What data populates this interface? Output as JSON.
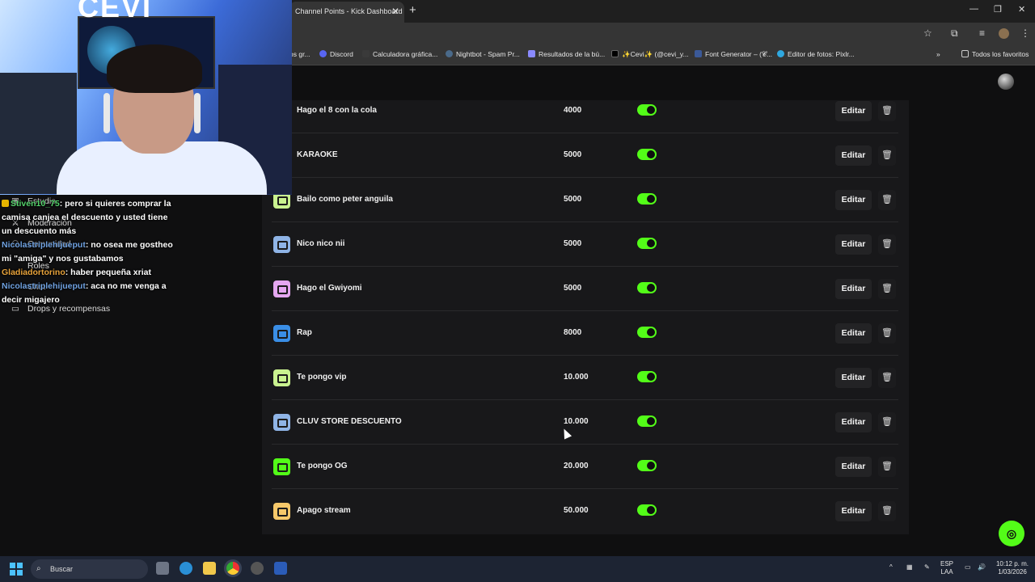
{
  "browser": {
    "tab_title": "Channel Points - Kick Dashboard",
    "tab_close": "✕",
    "new_tab": "+",
    "window_controls": [
      "—",
      "❐",
      "✕"
    ],
    "bookmarks": [
      {
        "label": "os gr...",
        "color": "#5b5b5b"
      },
      {
        "label": "Discord",
        "color": "#5865f2"
      },
      {
        "label": "Calculadora gráfica...",
        "color": "#3a3a3a"
      },
      {
        "label": "Nightbot - Spam Pr...",
        "color": "#4a6a8a"
      },
      {
        "label": "Resultados de la bú...",
        "color": "#8a8aff"
      },
      {
        "label": "✨Cevi✨ (@cevi_y...",
        "color": "#000000"
      },
      {
        "label": "Font Generator – (𝓒...",
        "color": "#3b5998"
      },
      {
        "label": "Editor de fotos: Pixlr...",
        "color": "#2fa8e0"
      }
    ],
    "all_favorites": "Todos los favoritos"
  },
  "rewards": [
    {
      "title": "Hago el 8 con la cola",
      "cost": "4000",
      "icon_color": "#a6f28f"
    },
    {
      "title": "KARAOKE",
      "cost": "5000",
      "icon_color": "#f6c86a"
    },
    {
      "title": "Bailo como peter anguila",
      "cost": "5000",
      "icon_color": "#c9f28f"
    },
    {
      "title": "Nico nico nii",
      "cost": "5000",
      "icon_color": "#8fb4e6"
    },
    {
      "title": "Hago el Gwiyomi",
      "cost": "5000",
      "icon_color": "#e4a6f0"
    },
    {
      "title": "Rap",
      "cost": "8000",
      "icon_color": "#3a8ee6"
    },
    {
      "title": "Te pongo vip",
      "cost": "10.000",
      "icon_color": "#c9f28f"
    },
    {
      "title": "CLUV STORE DESCUENTO",
      "cost": "10.000",
      "icon_color": "#8fb4e6"
    },
    {
      "title": "Te pongo OG",
      "cost": "20.000",
      "icon_color": "#53fc18"
    },
    {
      "title": "Apago stream",
      "cost": "50.000",
      "icon_color": "#f6c86a"
    }
  ],
  "row_actions": {
    "edit": "Editar",
    "delete": "🗑"
  },
  "sidebar": {
    "items": [
      {
        "icon": "▣",
        "label": "Estudio"
      },
      {
        "icon": "",
        "label": "Moderación"
      },
      {
        "icon": "⚇",
        "label": "Comunidad"
      },
      {
        "icon": "",
        "label": "Roles"
      },
      {
        "icon": "",
        "label": "Chat"
      },
      {
        "icon": "▭",
        "label": "Drops y recompensas"
      }
    ]
  },
  "chat": [
    {
      "user": "Stiven10_75",
      "text": ": pero si quieres comprar la camisa canjea el descuento y usted tiene un descuento más",
      "user_color": "green",
      "badge": true
    },
    {
      "user": "Nicolastriplehijueput",
      "text": ": no osea me gostheo mi \"amiga\" y nos gustabamos",
      "user_color": "blue",
      "badge": false
    },
    {
      "user": "Gladiadortorino",
      "text": ": haber pequeña xriat",
      "user_color": "orange",
      "badge": false
    },
    {
      "user": "Nicolastriplehijueput",
      "text": ": aca no me venga a decir migajero",
      "user_color": "blue",
      "badge": false
    }
  ],
  "webcam": {
    "logo_text": "CEVI"
  },
  "taskbar": {
    "search_placeholder": "Buscar",
    "lang_top": "ESP",
    "lang_bottom": "LAA",
    "time": "10:12 p. m.",
    "date": "1/03/2026"
  }
}
